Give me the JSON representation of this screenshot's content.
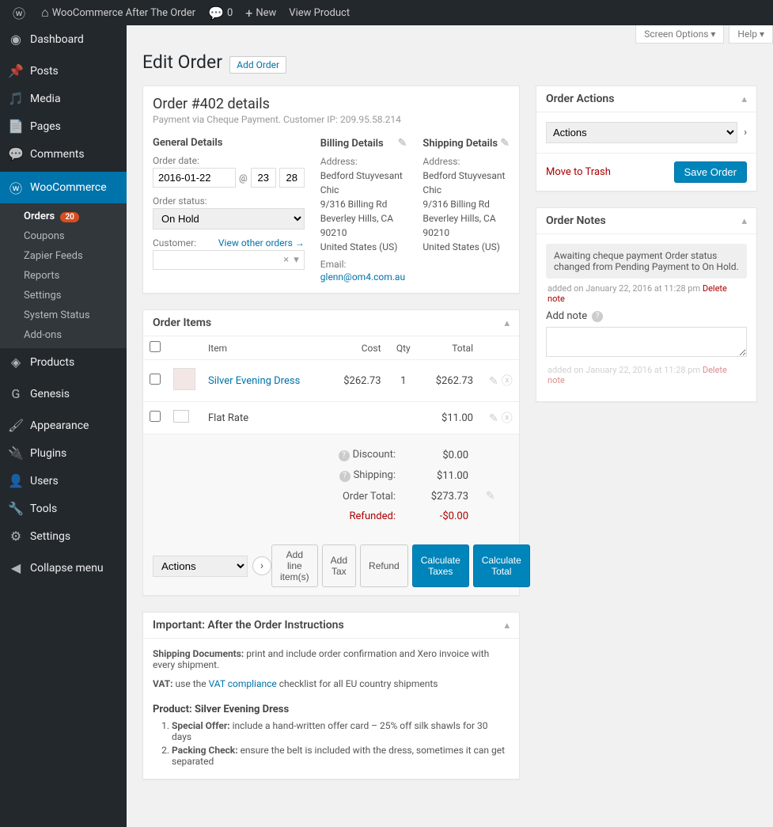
{
  "adminbar": {
    "site_title": "WooCommerce After The Order",
    "comment_count": "0",
    "new_label": "New",
    "view_product_label": "View Product"
  },
  "sidebar": {
    "dashboard": "Dashboard",
    "posts": "Posts",
    "media": "Media",
    "pages": "Pages",
    "comments": "Comments",
    "woocommerce": "WooCommerce",
    "woo_sub": {
      "orders": "Orders",
      "orders_badge": "20",
      "coupons": "Coupons",
      "zapier": "Zapier Feeds",
      "reports": "Reports",
      "settings": "Settings",
      "status": "System Status",
      "addons": "Add-ons"
    },
    "products": "Products",
    "genesis": "Genesis",
    "appearance": "Appearance",
    "plugins": "Plugins",
    "users": "Users",
    "tools": "Tools",
    "settings_main": "Settings",
    "collapse": "Collapse menu"
  },
  "screen_meta": {
    "screen_options": "Screen Options",
    "help": "Help"
  },
  "page": {
    "title": "Edit Order",
    "add_order": "Add Order"
  },
  "order": {
    "title": "Order #402 details",
    "subtitle": "Payment via Cheque Payment. Customer IP: 209.95.58.214",
    "general_heading": "General Details",
    "billing_heading": "Billing Details",
    "shipping_heading": "Shipping Details",
    "date_label": "Order date:",
    "date_value": "2016-01-22",
    "date_at": "@",
    "date_hour": "23",
    "date_min": "28",
    "status_label": "Order status:",
    "status_value": "On Hold",
    "customer_label": "Customer:",
    "view_other_orders": "View other orders →",
    "addr_label": "Address:",
    "addr_name": "Bedford Stuyvesant",
    "addr_company": "Chic",
    "addr_street": "9/316 Billing Rd",
    "addr_city": "Beverley Hills, CA 90210",
    "addr_country": "United States (US)",
    "email_label": "Email:",
    "email_value": "glenn@om4.com.au"
  },
  "items_box": {
    "title": "Order Items",
    "col_item": "Item",
    "col_cost": "Cost",
    "col_qty": "Qty",
    "col_total": "Total",
    "line1_name": "Silver Evening Dress",
    "line1_cost": "$262.73",
    "line1_qty": "1",
    "line1_total": "$262.73",
    "line2_name": "Flat Rate",
    "line2_total": "$11.00",
    "discount_label": "Discount:",
    "discount_val": "$0.00",
    "shipping_label": "Shipping:",
    "shipping_val": "$11.00",
    "ordertotal_label": "Order Total:",
    "ordertotal_val": "$273.73",
    "refunded_label": "Refunded:",
    "refunded_val": "-$0.00",
    "actions_label": "Actions",
    "btn_add_line": "Add line item(s)",
    "btn_add_tax": "Add Tax",
    "btn_refund": "Refund",
    "btn_calc_taxes": "Calculate Taxes",
    "btn_calc_total": "Calculate Total"
  },
  "instructions_box": {
    "title": "Important: After the Order Instructions",
    "ship_label": "Shipping Documents:",
    "ship_text": " print and include order confirmation and Xero invoice with every shipment.",
    "vat_label": "VAT:",
    "vat_before": " use the ",
    "vat_link": "VAT compliance",
    "vat_after": " checklist for all EU country shipments",
    "product_heading": "Product: Silver Evening Dress",
    "li1_label": "Special Offer:",
    "li1_text": " include a hand-written offer card – 25% off silk shawls for 30 days",
    "li2_label": "Packing Check:",
    "li2_text": " ensure the belt is included with the dress, sometimes it can get separated"
  },
  "order_actions_box": {
    "title": "Order Actions",
    "select_label": "Actions",
    "trash": "Move to Trash",
    "save": "Save Order"
  },
  "notes_box": {
    "title": "Order Notes",
    "note1": "Awaiting cheque payment Order status changed from Pending Payment to On Hold.",
    "note1_meta": "added on January 22, 2016 at 11:28 pm",
    "delete_note": "Delete note",
    "add_note_label": "Add note",
    "note2_meta": "added on January 22, 2016 at 11:28 pm"
  }
}
